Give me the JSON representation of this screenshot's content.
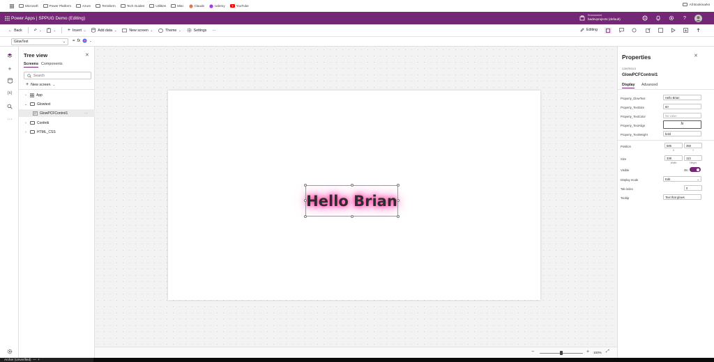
{
  "bookmarks": {
    "items": [
      {
        "label": "Microsoft"
      },
      {
        "label": "Power Platform"
      },
      {
        "label": "Azure"
      },
      {
        "label": "Terraform"
      },
      {
        "label": "Tech Guides"
      },
      {
        "label": "Utilities"
      },
      {
        "label": "Misc"
      },
      {
        "label": "Claude"
      },
      {
        "label": "Udemy"
      },
      {
        "label": "YouTube"
      }
    ],
    "all_bookmarks": "All Bookmarks"
  },
  "header": {
    "app_title": "Power Apps  |  SPPUG Demo (Editing)",
    "environment_label": "Environment",
    "environment_name": "badevprojects (default)",
    "brand_color": "#742774"
  },
  "command_bar": {
    "back": "Back",
    "insert": "Insert",
    "add_data": "Add data",
    "new_screen": "New screen",
    "theme": "Theme",
    "settings": "Settings",
    "more": "···",
    "editing": "Editing"
  },
  "formula_bar": {
    "property": "GlowText",
    "fx": "fx"
  },
  "tree": {
    "title": "Tree view",
    "tabs": [
      "Screens",
      "Components"
    ],
    "search_placeholder": "Search",
    "new_screen": "New screen",
    "items": [
      {
        "label": "App"
      },
      {
        "label": "Glowtext"
      },
      {
        "label": "GlowPCFControl1"
      },
      {
        "label": "Confetti"
      },
      {
        "label": "HTML_CSS"
      }
    ],
    "control_more": "···"
  },
  "canvas": {
    "glow_text": "Hello Brian",
    "glow_color": "#ff3fa8",
    "zoom_label": "100%"
  },
  "properties": {
    "title": "Properties",
    "section": "CONTROLS",
    "control_name": "GlowPCFControl1",
    "tabs": [
      "Display",
      "Advanced"
    ],
    "fields": [
      {
        "label": "Property_GlowText",
        "value": "Hello Brian"
      },
      {
        "label": "Property_TextSize",
        "value": "60"
      },
      {
        "label": "Property_TextColor",
        "value": "",
        "placeholder": "No value"
      },
      {
        "label": "Property_TextAlign",
        "value": "fx"
      },
      {
        "label": "Property_TextWeight",
        "value": "bold"
      }
    ],
    "position": {
      "label": "Position",
      "x": "585",
      "y": "350",
      "x_label": "X",
      "y_label": "Y"
    },
    "size": {
      "label": "Size",
      "width": "338",
      "height": "113",
      "width_label": "Width",
      "height_label": "Height"
    },
    "visible": {
      "label": "Visible",
      "state": "On"
    },
    "display_mode": {
      "label": "Display mode",
      "value": "Edit"
    },
    "tab_index": {
      "label": "Tab index",
      "value": "0"
    },
    "tooltip": {
      "label": "Tooltip",
      "value": "Text that glows"
    }
  },
  "taskbar": {
    "label": "Archer (Unverified)"
  }
}
